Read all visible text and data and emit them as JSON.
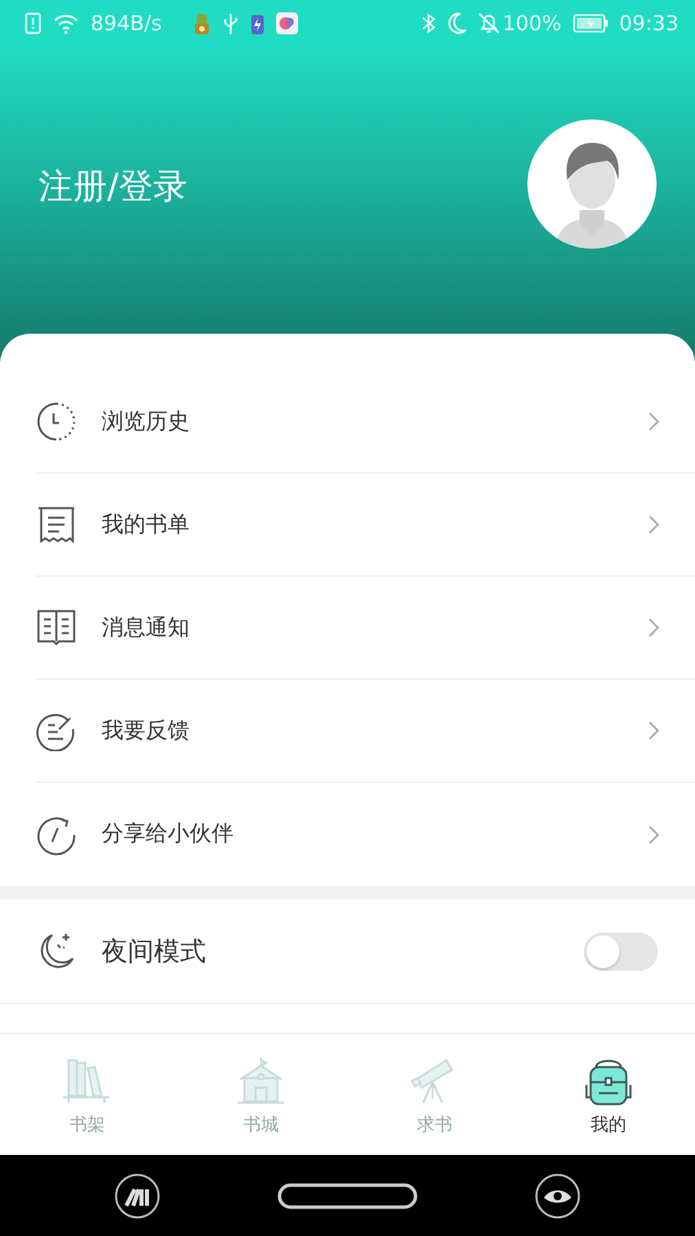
{
  "status_bar": {
    "net_speed": "894B/s",
    "battery": "100%",
    "time": "09:33"
  },
  "header": {
    "login": "注册/登录"
  },
  "menu": [
    {
      "kind": "history",
      "label": "浏览历史"
    },
    {
      "kind": "booklist",
      "label": "我的书单"
    },
    {
      "kind": "message",
      "label": "消息通知"
    },
    {
      "kind": "feedback",
      "label": "我要反馈"
    },
    {
      "kind": "share",
      "label": "分享给小伙伴"
    }
  ],
  "night_mode": {
    "label": "夜间模式",
    "on": false
  },
  "tabs": [
    {
      "kind": "shelf",
      "label": "书架",
      "selected": false
    },
    {
      "kind": "store",
      "label": "书城",
      "selected": false
    },
    {
      "kind": "request",
      "label": "求书",
      "selected": false
    },
    {
      "kind": "mine",
      "label": "我的",
      "selected": true
    }
  ]
}
